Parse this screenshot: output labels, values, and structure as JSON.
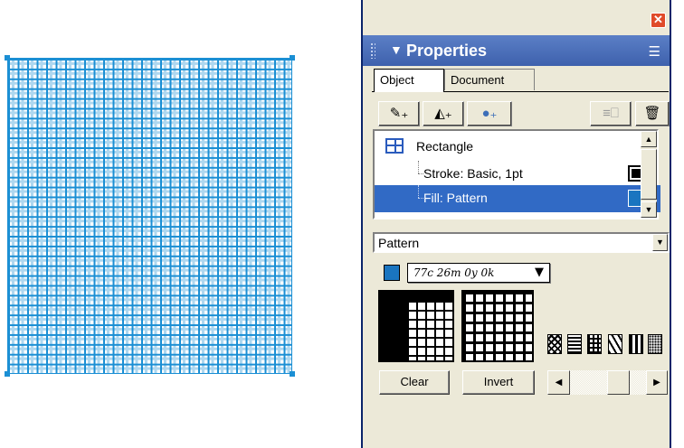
{
  "panel": {
    "title": "Properties",
    "title_arrow": "▼",
    "close_glyph": "✕",
    "options_glyph": "☰",
    "tabs": [
      {
        "label": "Object",
        "active": true
      },
      {
        "label": "Document",
        "active": false
      }
    ]
  },
  "toolbar": {
    "add_stroke": "✎₊",
    "add_fill": "◭₊",
    "add_effect": "●₊",
    "duplicate": "≡⎕",
    "delete": "🗑"
  },
  "attributes": {
    "object": "Rectangle",
    "stroke": "Stroke: Basic, 1pt",
    "fill": "Fill: Pattern",
    "stroke_color": "#000000",
    "fill_color": "#1a75c0"
  },
  "fill_settings": {
    "type": "Pattern",
    "pattern_name": "77c 26m 0y 0k",
    "pattern_color": "#1a75c0"
  },
  "buttons": {
    "clear": "Clear",
    "invert": "Invert"
  },
  "canvas": {
    "fill_color": "#1b8fd4"
  }
}
